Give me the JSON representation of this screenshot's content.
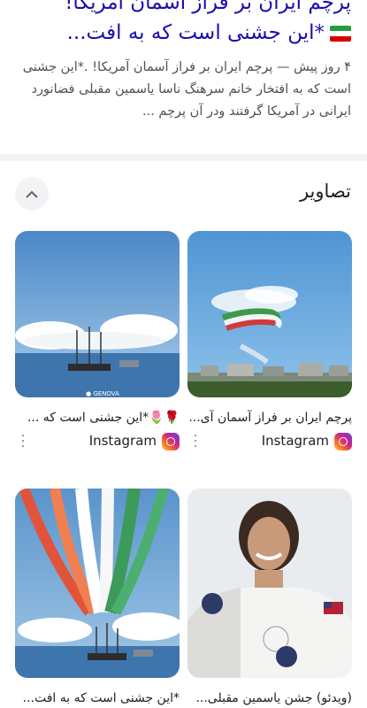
{
  "result": {
    "title_line1": "پرچم ایران بر فراز آسمان آمریکا!",
    "title_line2": "*این جشنی است که به افت...",
    "snippet": "۴ روز پیش — پرچم ایران بر فراز آسمان آمریکا! .*این جشنی است که به افتخار خانم سرهنگ ناسا یاسمین مقبلی فضانورد ایرانی در آمریکا گرفتند ودر آن پرچم ..."
  },
  "images": {
    "title": "تصاویر",
    "items": [
      {
        "caption": "پرچم ایران بر فراز آسمان آی...",
        "source": "Instagram"
      },
      {
        "caption": "🌹🌷*این جشنی است که ...",
        "source": "Instagram"
      },
      {
        "caption": "(ویدئو) جشن یاسمین مقبلی...",
        "source": ""
      },
      {
        "caption": "*این جشنی است که به افت...",
        "source": ""
      }
    ]
  },
  "colors": {
    "link": "#1a0dab",
    "snippet": "#4d5156",
    "divider": "#f1f3f4"
  }
}
